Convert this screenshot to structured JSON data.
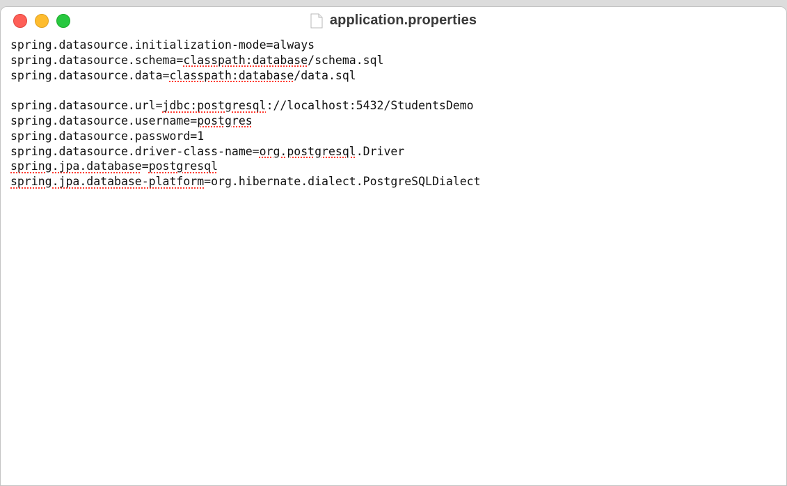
{
  "window": {
    "title": "application.properties",
    "icon": "document-icon"
  },
  "editor": {
    "lines": [
      [
        {
          "t": "spring.datasource.initialization-mode=always",
          "s": false
        }
      ],
      [
        {
          "t": "spring.datasource.schema=",
          "s": false
        },
        {
          "t": "classpath:database",
          "s": true
        },
        {
          "t": "/schema.sql",
          "s": false
        }
      ],
      [
        {
          "t": "spring.datasource.data=",
          "s": false
        },
        {
          "t": "classpath:database",
          "s": true
        },
        {
          "t": "/data.sql",
          "s": false
        }
      ],
      [
        {
          "t": "",
          "s": false
        }
      ],
      [
        {
          "t": "spring.datasource.url=",
          "s": false
        },
        {
          "t": "jdbc:postgresql",
          "s": true
        },
        {
          "t": "://localhost:5432/StudentsDemo",
          "s": false
        }
      ],
      [
        {
          "t": "spring.datasource.username=",
          "s": false
        },
        {
          "t": "postgres",
          "s": true
        }
      ],
      [
        {
          "t": "spring.datasource.password=1",
          "s": false
        }
      ],
      [
        {
          "t": "spring.datasource.driver-class-name=",
          "s": false
        },
        {
          "t": "org.postgresql",
          "s": true
        },
        {
          "t": ".Driver",
          "s": false
        }
      ],
      [
        {
          "t": "spring.jpa.database",
          "s": true
        },
        {
          "t": "=",
          "s": false
        },
        {
          "t": "postgresql",
          "s": true
        }
      ],
      [
        {
          "t": "spring.jpa.database-platform",
          "s": true
        },
        {
          "t": "=org.hibernate.dialect.PostgreSQLDialect",
          "s": false
        }
      ]
    ]
  },
  "colors": {
    "close": "#fe5f57",
    "minimize": "#febc2e",
    "zoom": "#28c840",
    "spellcheck_underline": "#ff3b30"
  }
}
